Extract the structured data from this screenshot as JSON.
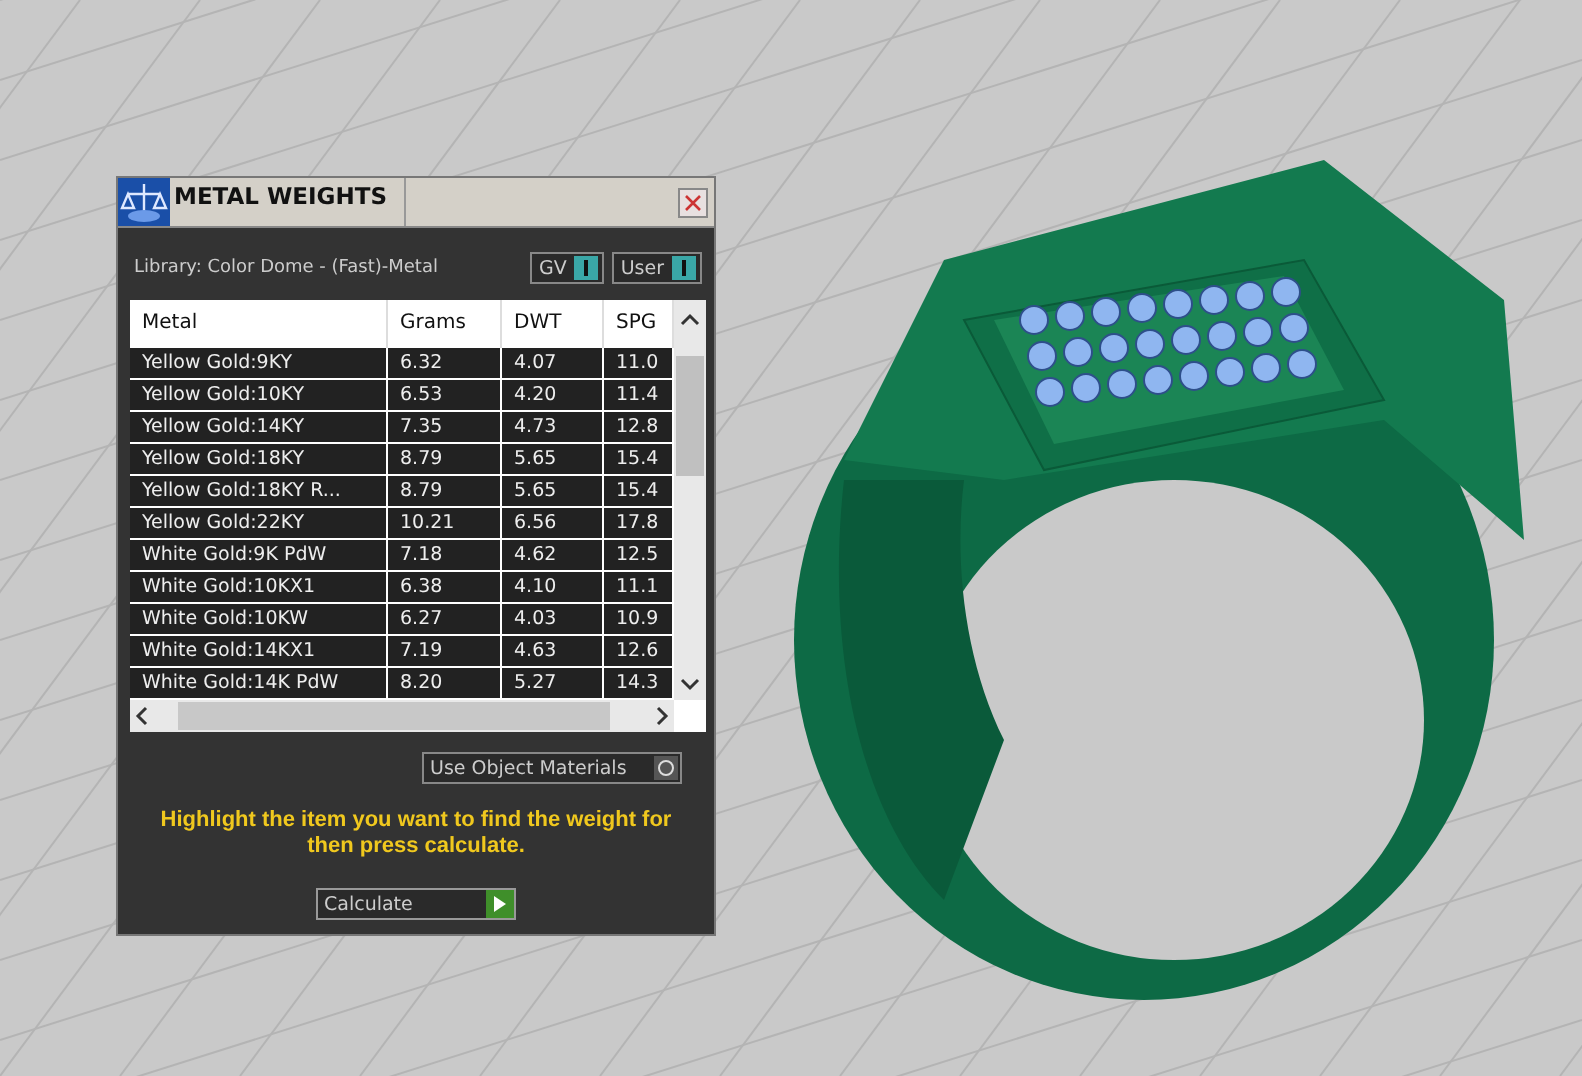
{
  "window": {
    "title": "METAL WEIGHTS"
  },
  "library": "Library: Color Dome - (Fast)-Metal",
  "toggles": [
    {
      "label": "GV",
      "on": true
    },
    {
      "label": "User",
      "on": true
    }
  ],
  "table": {
    "columns": [
      "Metal",
      "Grams",
      "DWT",
      "SPG"
    ],
    "rows": [
      [
        "Yellow Gold:9KY",
        "6.32",
        "4.07",
        "11.0"
      ],
      [
        "Yellow Gold:10KY",
        "6.53",
        "4.20",
        "11.4"
      ],
      [
        "Yellow Gold:14KY",
        "7.35",
        "4.73",
        "12.8"
      ],
      [
        "Yellow Gold:18KY",
        "8.79",
        "5.65",
        "15.4"
      ],
      [
        "Yellow Gold:18KY R...",
        "8.79",
        "5.65",
        "15.4"
      ],
      [
        "Yellow Gold:22KY",
        "10.21",
        "6.56",
        "17.8"
      ],
      [
        "White Gold:9K PdW",
        "7.18",
        "4.62",
        "12.5"
      ],
      [
        "White Gold:10KX1",
        "6.38",
        "4.10",
        "11.1"
      ],
      [
        "White Gold:10KW",
        "6.27",
        "4.03",
        "10.9"
      ],
      [
        "White Gold:14KX1",
        "7.19",
        "4.63",
        "12.6"
      ],
      [
        "White Gold:14K PdW",
        "8.20",
        "5.27",
        "14.3"
      ]
    ]
  },
  "use_object_materials": {
    "label": "Use Object Materials",
    "on": false
  },
  "hint": "Highlight the item you want to find the weight for then press calculate.",
  "calculate_button": "Calculate"
}
